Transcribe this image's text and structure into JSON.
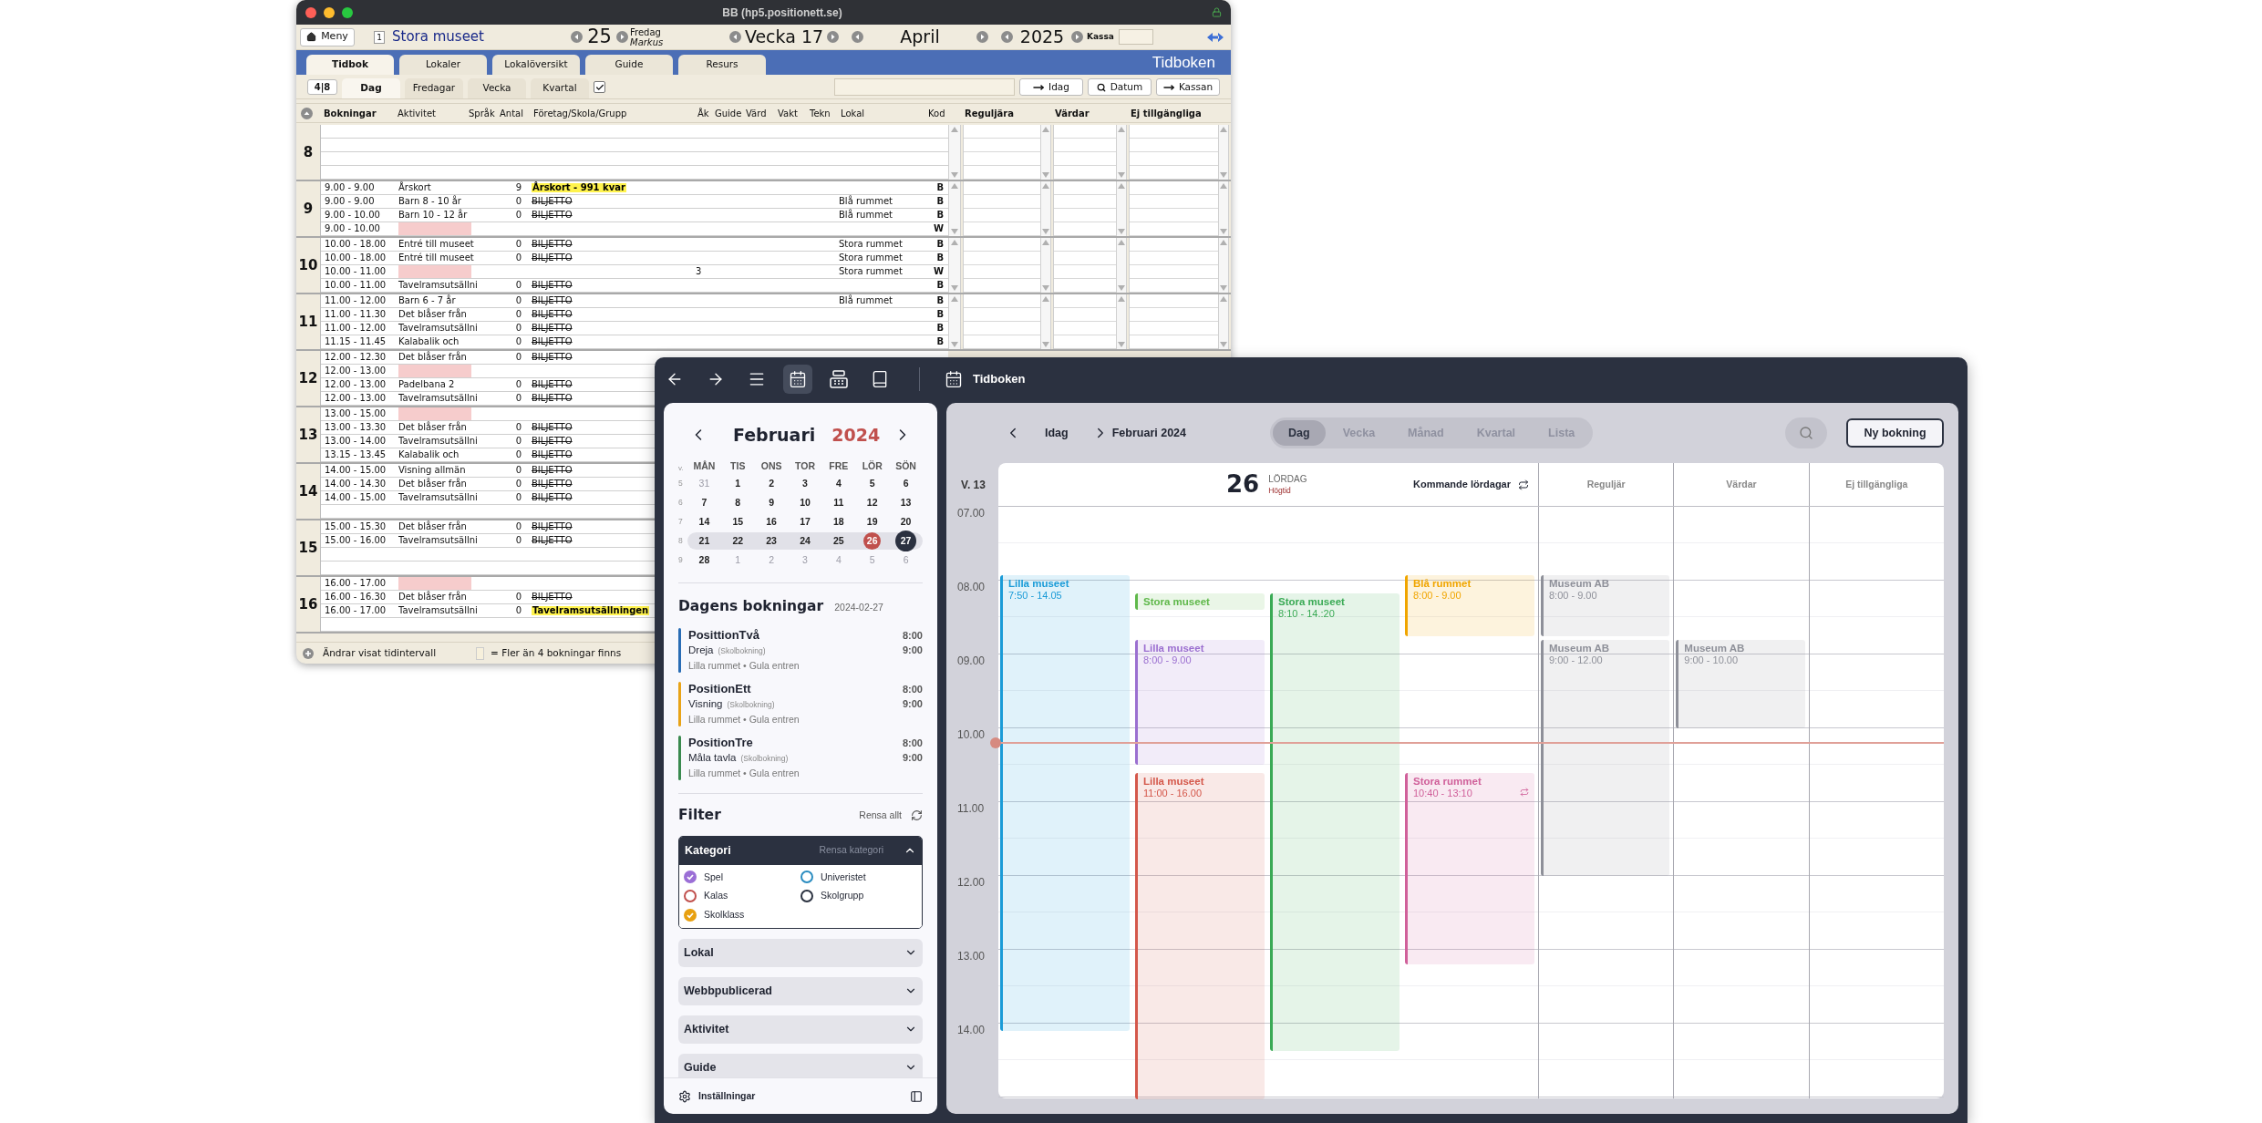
{
  "old_window": {
    "title": "BB (hp5.positionett.se)",
    "toolbar": {
      "menu": "Meny",
      "number": "1",
      "venue": "Stora museet",
      "day": "25",
      "weekday": "Fredag",
      "user": "Markus",
      "week": "Vecka 17",
      "month": "April",
      "year": "2025",
      "cash_label": "Kassa"
    },
    "tabs": [
      {
        "label": "Tidbok",
        "selected": true
      },
      {
        "label": "Lokaler",
        "selected": false
      },
      {
        "label": "Lokalöversikt",
        "selected": false
      },
      {
        "label": "Guide",
        "selected": false
      },
      {
        "label": "Resurs",
        "selected": false
      }
    ],
    "app_title": "Tidboken",
    "range_button": "4|8",
    "view_tabs": [
      {
        "label": "Dag",
        "selected": true
      },
      {
        "label": "Fredagar",
        "selected": false
      },
      {
        "label": "Vecka",
        "selected": false
      },
      {
        "label": "Kvartal",
        "selected": false
      }
    ],
    "view_checkbox": {
      "checked": true
    },
    "buttons": [
      {
        "label": "Idag",
        "kind": "go"
      },
      {
        "label": "Datum",
        "kind": "search"
      },
      {
        "label": "Kassan",
        "kind": "go"
      }
    ],
    "columns": [
      "Bokningar",
      "Aktivitet",
      "Språk",
      "Antal",
      "Företag/Skola/Grupp",
      "Åk",
      "Guide",
      "Värd",
      "Vakt",
      "Tekn",
      "Lokal",
      "Kod",
      "Reguljära",
      "Värdar",
      "Ej tillgängliga"
    ],
    "hours": [
      {
        "hour": "8"
      },
      {
        "hour": "9",
        "rows": [
          {
            "kind": "booking",
            "time": "9.00 - 9.00",
            "activity": "Årskort",
            "count": "9",
            "company": "Årskort - 991 kvar",
            "highlighted": true,
            "struck": false,
            "code": "B"
          },
          {
            "kind": "booking",
            "time": "9.00 - 9.00",
            "activity": "Barn 8 - 10 år",
            "count": "0",
            "company": "BILJETTO",
            "highlighted": false,
            "struck": true,
            "room": "Blå rummet",
            "code": "B"
          },
          {
            "kind": "booking",
            "time": "9.00 - 10.00",
            "activity": "Barn 10 - 12 år",
            "count": "0",
            "company": "BILJETTO",
            "highlighted": false,
            "struck": true,
            "room": "Blå rummet",
            "code": "B"
          },
          {
            "kind": "blocked",
            "time": "9.00 - 10.00",
            "code": "W"
          }
        ]
      },
      {
        "hour": "10",
        "rows": [
          {
            "kind": "booking",
            "time": "10.00 - 18.00",
            "activity": "Entré till museet",
            "count": "0",
            "company": "BILJETTO",
            "highlighted": false,
            "struck": true,
            "room": "Stora rummet",
            "code": "B"
          },
          {
            "kind": "booking",
            "time": "10.00 - 18.00",
            "activity": "Entré till museet",
            "count": "0",
            "company": "BILJETTO",
            "highlighted": false,
            "struck": true,
            "room": "Stora rummet",
            "code": "B"
          },
          {
            "kind": "blocked",
            "time": "10.00 - 11.00",
            "grade": "3",
            "room": "Stora rummet",
            "code": "W"
          },
          {
            "kind": "booking",
            "time": "10.00 - 11.00",
            "activity": "Tavelramsutsällni",
            "count": "0",
            "company": "BILJETTO",
            "highlighted": false,
            "struck": true,
            "code": "B"
          }
        ]
      },
      {
        "hour": "11",
        "rows": [
          {
            "kind": "booking",
            "time": "11.00 - 12.00",
            "activity": "Barn 6 - 7 år",
            "count": "0",
            "company": "BILJETTO",
            "highlighted": false,
            "struck": true,
            "room": "Blå rummet",
            "code": "B"
          },
          {
            "kind": "booking",
            "time": "11.00 - 11.30",
            "activity": "Det blåser från",
            "count": "0",
            "company": "BILJETTO",
            "highlighted": false,
            "struck": true,
            "code": "B"
          },
          {
            "kind": "booking",
            "time": "11.00 - 12.00",
            "activity": "Tavelramsutsällni",
            "count": "0",
            "company": "BILJETTO",
            "highlighted": false,
            "struck": true,
            "code": "B"
          },
          {
            "kind": "booking",
            "time": "11.15 - 11.45",
            "activity": "Kalabalik och",
            "count": "0",
            "company": "BILJETTO",
            "highlighted": false,
            "struck": true,
            "code": "B"
          }
        ]
      },
      {
        "hour": "12",
        "rows": [
          {
            "kind": "booking",
            "time": "12.00 - 12.30",
            "activity": "Det blåser från",
            "count": "0",
            "company": "BILJETTO",
            "highlighted": false,
            "struck": true
          },
          {
            "kind": "blocked",
            "time": "12.00 - 13.00"
          },
          {
            "kind": "booking",
            "time": "12.00 - 13.00",
            "activity": "Padelbana 2",
            "count": "0",
            "company": "BILJETTO",
            "highlighted": false,
            "struck": true
          },
          {
            "kind": "booking",
            "time": "12.00 - 13.00",
            "activity": "Tavelramsutsällni",
            "count": "0",
            "company": "BILJETTO",
            "highlighted": false,
            "struck": true
          }
        ]
      },
      {
        "hour": "13",
        "rows": [
          {
            "kind": "blocked",
            "time": "13.00 - 15.00"
          },
          {
            "kind": "booking",
            "time": "13.00 - 13.30",
            "activity": "Det blåser från",
            "count": "0",
            "company": "BILJETTO",
            "highlighted": false,
            "struck": true
          },
          {
            "kind": "booking",
            "time": "13.00 - 14.00",
            "activity": "Tavelramsutsällni",
            "count": "0",
            "company": "BILJETTO",
            "highlighted": false,
            "struck": true
          },
          {
            "kind": "booking",
            "time": "13.15 - 13.45",
            "activity": "Kalabalik och",
            "count": "0",
            "company": "BILJETTO",
            "highlighted": false,
            "struck": true
          }
        ]
      },
      {
        "hour": "14",
        "rows": [
          {
            "kind": "booking",
            "time": "14.00 - 15.00",
            "activity": "Visning allmän",
            "count": "0",
            "company": "BILJETTO",
            "highlighted": false,
            "struck": true
          },
          {
            "kind": "booking",
            "time": "14.00 - 14.30",
            "activity": "Det blåser från",
            "count": "0",
            "company": "BILJETTO",
            "highlighted": false,
            "struck": true
          },
          {
            "kind": "booking",
            "time": "14.00 - 15.00",
            "activity": "Tavelramsutsällni",
            "count": "0",
            "company": "BILJETTO",
            "highlighted": false,
            "struck": true
          }
        ]
      },
      {
        "hour": "15",
        "rows": [
          {
            "kind": "booking",
            "time": "15.00 - 15.30",
            "activity": "Det blåser från",
            "count": "0",
            "company": "BILJETTO",
            "highlighted": false,
            "struck": true
          },
          {
            "kind": "booking",
            "time": "15.00 - 16.00",
            "activity": "Tavelramsutsällni",
            "count": "0",
            "company": "BILJETTO",
            "highlighted": false,
            "struck": true
          }
        ]
      },
      {
        "hour": "16",
        "rows": [
          {
            "kind": "blocked",
            "time": "16.00 - 17.00"
          },
          {
            "kind": "booking",
            "time": "16.00 - 16.30",
            "activity": "Det blåser från",
            "count": "0",
            "company": "BILJETTO",
            "highlighted": false,
            "struck": true
          },
          {
            "kind": "booking",
            "time": "16.00 - 17.00",
            "activity": "Tavelramsutsällni",
            "count": "0",
            "company": "Tavelramsutsällningen",
            "highlighted": true,
            "struck": false
          }
        ]
      }
    ],
    "footer": {
      "hint": "Ändrar visat tidintervall",
      "legend": "= Fler än 4 bokningar finns"
    }
  },
  "app": {
    "toolbar_icons": [
      {
        "kind": "back",
        "selected": false
      },
      {
        "kind": "forward",
        "selected": false
      },
      {
        "kind": "menu",
        "selected": false
      },
      {
        "kind": "calendar",
        "selected": true
      },
      {
        "kind": "register",
        "selected": false
      },
      {
        "kind": "book",
        "selected": false
      }
    ],
    "title": "Tidboken",
    "mini_calendar": {
      "month": "Februari",
      "year": "2024",
      "week_label": "v.",
      "weekdays": [
        "MÅN",
        "TIS",
        "ONS",
        "TOR",
        "FRE",
        "LÖR",
        "SÖN"
      ],
      "weeks": [
        {
          "number": "5",
          "selected": false,
          "days": [
            {
              "label": "31",
              "muted": true,
              "today": false,
              "selected": false
            },
            {
              "label": "1",
              "muted": false,
              "today": false,
              "selected": false
            },
            {
              "label": "2",
              "muted": false,
              "today": false,
              "selected": false
            },
            {
              "label": "3",
              "muted": false,
              "today": false,
              "selected": false
            },
            {
              "label": "4",
              "muted": false,
              "today": false,
              "selected": false
            },
            {
              "label": "5",
              "muted": false,
              "today": false,
              "selected": false
            },
            {
              "label": "6",
              "muted": false,
              "today": false,
              "selected": false
            }
          ]
        },
        {
          "number": "6",
          "selected": false,
          "days": [
            {
              "label": "7",
              "muted": false,
              "today": false,
              "selected": false
            },
            {
              "label": "8",
              "muted": false,
              "today": false,
              "selected": false
            },
            {
              "label": "9",
              "muted": false,
              "today": false,
              "selected": false
            },
            {
              "label": "10",
              "muted": false,
              "today": false,
              "selected": false
            },
            {
              "label": "11",
              "muted": false,
              "today": false,
              "selected": false
            },
            {
              "label": "12",
              "muted": false,
              "today": false,
              "selected": false
            },
            {
              "label": "13",
              "muted": false,
              "today": false,
              "selected": false
            }
          ]
        },
        {
          "number": "7",
          "selected": false,
          "days": [
            {
              "label": "14",
              "muted": false,
              "today": false,
              "selected": false
            },
            {
              "label": "15",
              "muted": false,
              "today": false,
              "selected": false
            },
            {
              "label": "16",
              "muted": false,
              "today": false,
              "selected": false
            },
            {
              "label": "17",
              "muted": false,
              "today": false,
              "selected": false
            },
            {
              "label": "18",
              "muted": false,
              "today": false,
              "selected": false
            },
            {
              "label": "19",
              "muted": false,
              "today": false,
              "selected": false
            },
            {
              "label": "20",
              "muted": false,
              "today": false,
              "selected": false
            }
          ]
        },
        {
          "number": "8",
          "selected": true,
          "days": [
            {
              "label": "21",
              "muted": false,
              "today": false,
              "selected": false
            },
            {
              "label": "22",
              "muted": false,
              "today": false,
              "selected": false
            },
            {
              "label": "23",
              "muted": false,
              "today": false,
              "selected": false
            },
            {
              "label": "24",
              "muted": false,
              "today": false,
              "selected": false
            },
            {
              "label": "25",
              "muted": false,
              "today": false,
              "selected": false
            },
            {
              "label": "26",
              "muted": false,
              "today": true,
              "selected": false
            },
            {
              "label": "27",
              "muted": false,
              "today": false,
              "selected": true
            }
          ]
        },
        {
          "number": "9",
          "selected": false,
          "days": [
            {
              "label": "28",
              "muted": false,
              "today": false,
              "selected": false
            },
            {
              "label": "1",
              "muted": true,
              "today": false,
              "selected": false
            },
            {
              "label": "2",
              "muted": true,
              "today": false,
              "selected": false
            },
            {
              "label": "3",
              "muted": true,
              "today": false,
              "selected": false
            },
            {
              "label": "4",
              "muted": true,
              "today": false,
              "selected": false
            },
            {
              "label": "5",
              "muted": true,
              "today": false,
              "selected": false
            },
            {
              "label": "6",
              "muted": true,
              "today": false,
              "selected": false
            }
          ]
        }
      ]
    },
    "todays_bookings": {
      "title": "Dagens bokningar",
      "date": "2024-02-27",
      "items": [
        {
          "name": "PosittionTvå",
          "activity": "Dreja",
          "type": "(Skolbokning)",
          "place": "Lilla rummet • Gula entren",
          "start": "8:00",
          "end": "9:00",
          "color": "#2a6db5"
        },
        {
          "name": "PositionEtt",
          "activity": "Visning",
          "type": "(Skolbokning)",
          "place": "Lilla rummet • Gula entren",
          "start": "8:00",
          "end": "9:00",
          "color": "#e8a317"
        },
        {
          "name": "PositionTre",
          "activity": "Måla tavla",
          "type": "(Skolbokning)",
          "place": "Lilla rummet • Gula entren",
          "start": "8:00",
          "end": "9:00",
          "color": "#3a8a4f"
        }
      ]
    },
    "filter": {
      "title": "Filter",
      "clear_all": "Rensa allt",
      "category": {
        "title": "Kategori",
        "clear": "Rensa kategori",
        "expanded": true,
        "options": [
          {
            "label": "Spel",
            "checked": true,
            "color": "#9b6fd6"
          },
          {
            "label": "Univeristet",
            "checked": false,
            "color": "#2a8cc0"
          },
          {
            "label": "Kalas",
            "checked": false,
            "color": "#c0504d"
          },
          {
            "label": "Skolgrupp",
            "checked": false,
            "color": "#2b3240"
          },
          {
            "label": "Skolklass",
            "checked": true,
            "color": "#e8a010"
          }
        ]
      },
      "sections": [
        {
          "label": "Lokal",
          "expanded": false
        },
        {
          "label": "Webbpublicerad",
          "expanded": false
        },
        {
          "label": "Aktivitet",
          "expanded": false
        },
        {
          "label": "Guide",
          "expanded": false
        }
      ]
    },
    "settings": "Inställningar",
    "calendar": {
      "today": "Idag",
      "period": "Februari 2024",
      "views": [
        {
          "label": "Dag",
          "selected": true
        },
        {
          "label": "Vecka",
          "selected": false
        },
        {
          "label": "Månad",
          "selected": false
        },
        {
          "label": "Kvartal",
          "selected": false
        },
        {
          "label": "Lista",
          "selected": false
        }
      ],
      "new_button": "Ny bokning",
      "week": "V. 13",
      "hours": [
        "07.00",
        "08.00",
        "09.00",
        "10.00",
        "11.00",
        "12.00",
        "13.00",
        "14.00"
      ],
      "day": {
        "number": "26",
        "weekday": "LÖRDAG",
        "note": "Högtid",
        "upcoming": "Kommande lördagar"
      },
      "lanes": [
        {
          "events": [
            {
              "title": "Lilla museet",
              "time": "7:50 - 14.05",
              "color": "#1a9bd7",
              "recurring": false
            }
          ]
        },
        {
          "events": [
            {
              "title": "Stora museet",
              "color": "#5fb84a",
              "recurring": false
            },
            {
              "title": "Lilla museet",
              "time": "8:00 - 9.00",
              "color": "#9b6fd0",
              "recurring": false
            },
            {
              "title": "Lilla museet",
              "time": "11:00 - 16.00",
              "color": "#d4574a",
              "recurring": false
            }
          ]
        },
        {
          "events": [
            {
              "title": "Stora museet",
              "time": "8:10 - 14.:20",
              "color": "#3aaa55",
              "recurring": false
            }
          ]
        },
        {
          "events": [
            {
              "title": "Blå rummet",
              "time": "8:00 - 9.00",
              "color": "#f0a500",
              "recurring": false
            },
            {
              "title": "Stora rummet",
              "time": "10:40 - 13:10",
              "color": "#d0609a",
              "recurring": true
            }
          ]
        }
      ],
      "side_columns": [
        {
          "title": "Reguljär",
          "events": [
            {
              "title": "Museum AB",
              "time": "8:00 - 9.00",
              "color": "#8e9099",
              "recurring": false
            },
            {
              "title": "Museum AB",
              "time": "9:00 - 12.00",
              "color": "#8e9099",
              "recurring": false
            }
          ]
        },
        {
          "title": "Värdar",
          "events": [
            {
              "title": "Museum AB",
              "time": "9:00 - 10.00",
              "color": "#8e9099",
              "recurring": false
            }
          ]
        },
        {
          "title": "Ej tillgängliga"
        }
      ]
    }
  }
}
